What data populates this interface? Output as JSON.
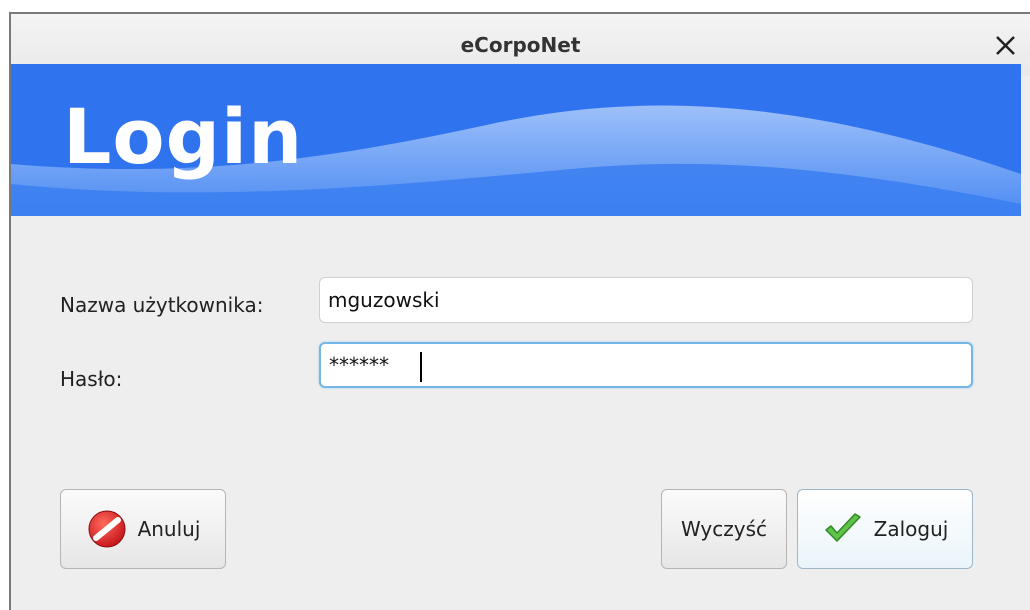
{
  "window": {
    "title": "eCorpoNet",
    "close_glyph": "✕"
  },
  "banner": {
    "title": "Login",
    "color": "#2f74ee"
  },
  "form": {
    "username_label": "Nazwa użytkownika:",
    "username_value": "mguzowski",
    "password_label": "Hasło:",
    "password_value": "******"
  },
  "buttons": {
    "cancel_label": "Anuluj",
    "cancel_icon": "cancel-icon",
    "clear_label": "Wyczyść",
    "login_label": "Zaloguj",
    "login_icon": "checkmark-icon"
  }
}
